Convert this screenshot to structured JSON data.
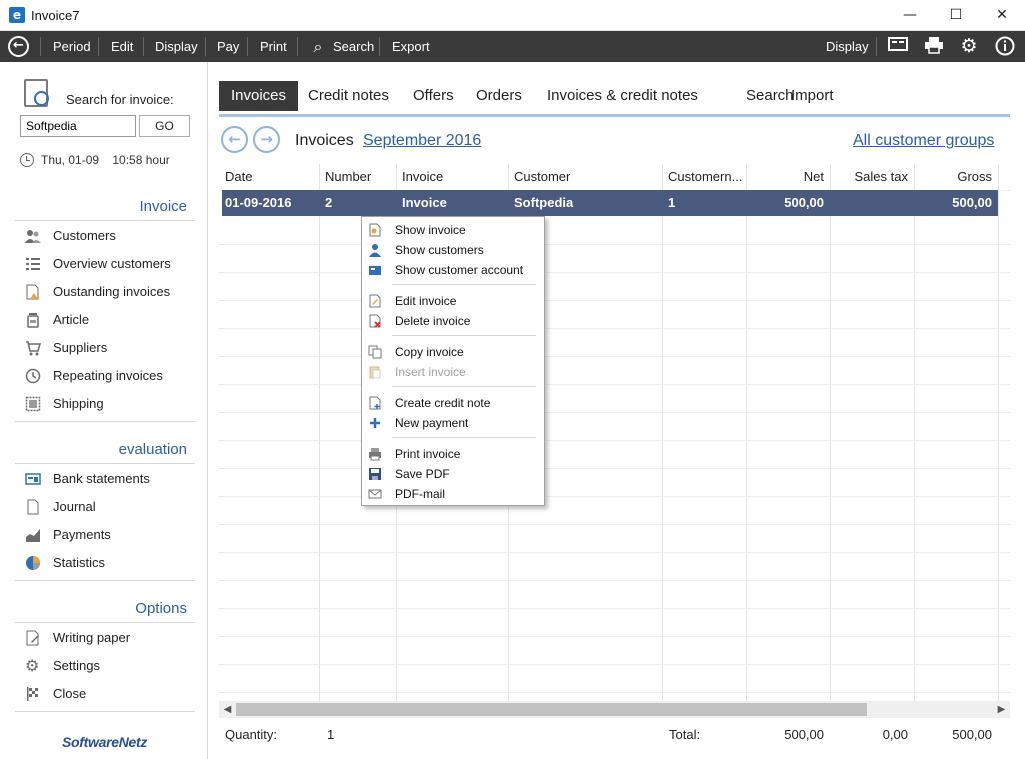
{
  "window": {
    "title": "Invoice7",
    "minimize": "—",
    "maximize": "☐",
    "close": "✕"
  },
  "toolbar": {
    "items": [
      "Period",
      "Edit",
      "Display",
      "Pay",
      "Print",
      "Search",
      "Export"
    ],
    "right_label": "Display"
  },
  "sidebar": {
    "search_label": "Search for invoice:",
    "search_value": "Softpedia",
    "go_label": "GO",
    "datetime": "Thu, 01-09    10:58 hour",
    "sections": [
      {
        "title": "Invoice",
        "items": [
          "Customers",
          "Overview customers",
          "Oustanding invoices",
          "Article",
          "Suppliers",
          "Repeating invoices",
          "Shipping"
        ]
      },
      {
        "title": "evaluation",
        "items": [
          "Bank statements",
          "Journal",
          "Payments",
          "Statistics"
        ]
      },
      {
        "title": "Options",
        "items": [
          "Writing paper",
          "Settings",
          "Close"
        ]
      }
    ],
    "logo": "SoftwareNetz"
  },
  "tabs": [
    "Invoices",
    "Credit notes",
    "Offers",
    "Orders",
    "Invoices & credit notes",
    "Search",
    "Import"
  ],
  "header": {
    "label": "Invoices",
    "period": "September 2016",
    "groups": "All customer groups"
  },
  "grid": {
    "columns": [
      "Date",
      "Number",
      "Invoice",
      "Customer",
      "Customern...",
      "Net",
      "Sales tax",
      "Gross"
    ],
    "rows": [
      [
        "01-09-2016",
        "2",
        "Invoice",
        "Softpedia",
        "1",
        "500,00",
        "",
        "500,00"
      ]
    ]
  },
  "footer": {
    "quantity_label": "Quantity:",
    "quantity": "1",
    "total_label": "Total:",
    "net": "500,00",
    "tax": "0,00",
    "gross": "500,00"
  },
  "context_menu": {
    "items": [
      {
        "label": "Show invoice",
        "enabled": true
      },
      {
        "label": "Show customers",
        "enabled": true
      },
      {
        "label": "Show customer account",
        "enabled": true
      },
      {
        "label": "Edit invoice",
        "enabled": true
      },
      {
        "label": "Delete invoice",
        "enabled": true
      },
      {
        "label": "Copy invoice",
        "enabled": true
      },
      {
        "label": "Insert invoice",
        "enabled": false
      },
      {
        "label": "Create credit note",
        "enabled": true
      },
      {
        "label": "New payment",
        "enabled": true
      },
      {
        "label": "Print invoice",
        "enabled": true
      },
      {
        "label": "Save PDF",
        "enabled": true
      },
      {
        "label": "PDF-mail",
        "enabled": true
      }
    ]
  },
  "colors": {
    "accent": "#2a5ea8",
    "toolbar": "#3a3a3a",
    "selection": "#4a5a7e",
    "tab_underline": "#a8c3e2"
  }
}
